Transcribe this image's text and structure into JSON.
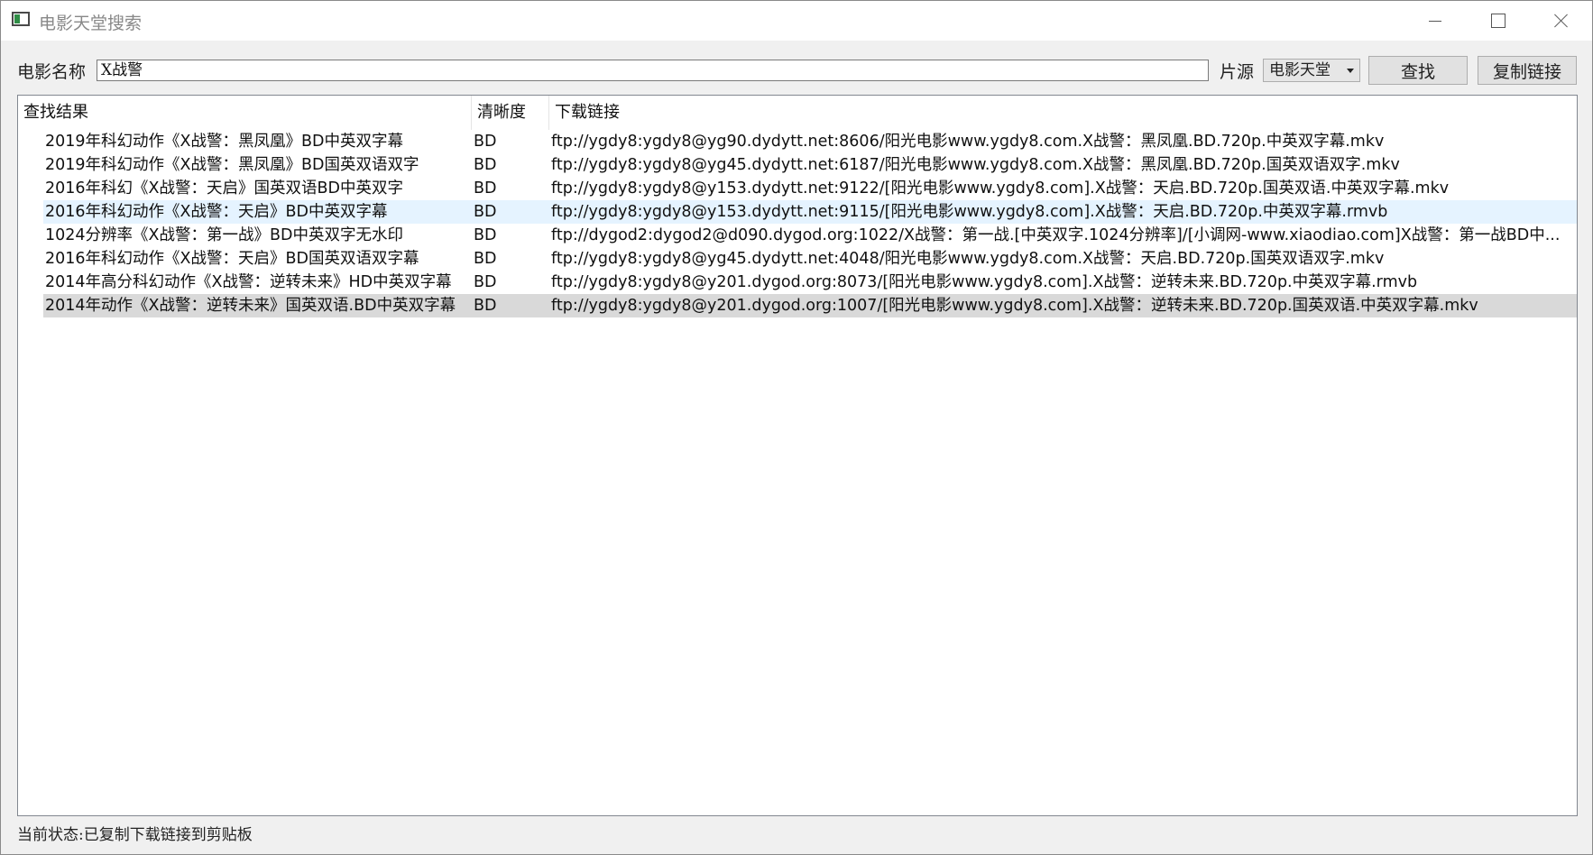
{
  "window": {
    "title": "电影天堂搜索"
  },
  "toolbar": {
    "name_label": "电影名称",
    "name_value": "X战警",
    "source_label": "片源",
    "source_selected": "电影天堂",
    "search_label": "查找",
    "copy_label": "复制链接"
  },
  "table": {
    "headers": [
      "查找结果",
      "清晰度",
      "下载链接"
    ],
    "rows": [
      {
        "title": "2019年科幻动作《X战警：黑凤凰》BD中英双字幕",
        "quality": "BD",
        "link": "ftp://ygdy8:ygdy8@yg90.dydytt.net:8606/阳光电影www.ygdy8.com.X战警：黑凤凰.BD.720p.中英双字幕.mkv"
      },
      {
        "title": "2019年科幻动作《X战警：黑凤凰》BD国英双语双字",
        "quality": "BD",
        "link": "ftp://ygdy8:ygdy8@yg45.dydytt.net:6187/阳光电影www.ygdy8.com.X战警：黑凤凰.BD.720p.国英双语双字.mkv"
      },
      {
        "title": "2016年科幻《X战警：天启》国英双语BD中英双字",
        "quality": "BD",
        "link": "ftp://ygdy8:ygdy8@y153.dydytt.net:9122/[阳光电影www.ygdy8.com].X战警：天启.BD.720p.国英双语.中英双字幕.mkv"
      },
      {
        "title": "2016年科幻动作《X战警：天启》BD中英双字幕",
        "quality": "BD",
        "link": "ftp://ygdy8:ygdy8@y153.dydytt.net:9115/[阳光电影www.ygdy8.com].X战警：天启.BD.720p.中英双字幕.rmvb"
      },
      {
        "title": "1024分辨率《X战警：第一战》BD中英双字无水印",
        "quality": "BD",
        "link": "ftp://dygod2:dygod2@d090.dygod.org:1022/X战警：第一战.[中英双字.1024分辨率]/[小调网-www.xiaodiao.com]X战警：第一战BD中..."
      },
      {
        "title": "2016年科幻动作《X战警：天启》BD国英双语双字幕",
        "quality": "BD",
        "link": "ftp://ygdy8:ygdy8@yg45.dydytt.net:4048/阳光电影www.ygdy8.com.X战警：天启.BD.720p.国英双语双字.mkv"
      },
      {
        "title": "2014年高分科幻动作《X战警：逆转未来》HD中英双字幕",
        "quality": "BD",
        "link": "ftp://ygdy8:ygdy8@y201.dygod.org:8073/[阳光电影www.ygdy8.com].X战警：逆转未来.BD.720p.中英双字幕.rmvb"
      },
      {
        "title": "2014年动作《X战警：逆转未来》国英双语.BD中英双字幕",
        "quality": "BD",
        "link": "ftp://ygdy8:ygdy8@y201.dygod.org:1007/[阳光电影www.ygdy8.com].X战警：逆转未来.BD.720p.国英双语.中英双字幕.mkv"
      }
    ]
  },
  "status": {
    "text": "当前状态:已复制下载链接到剪贴板"
  }
}
